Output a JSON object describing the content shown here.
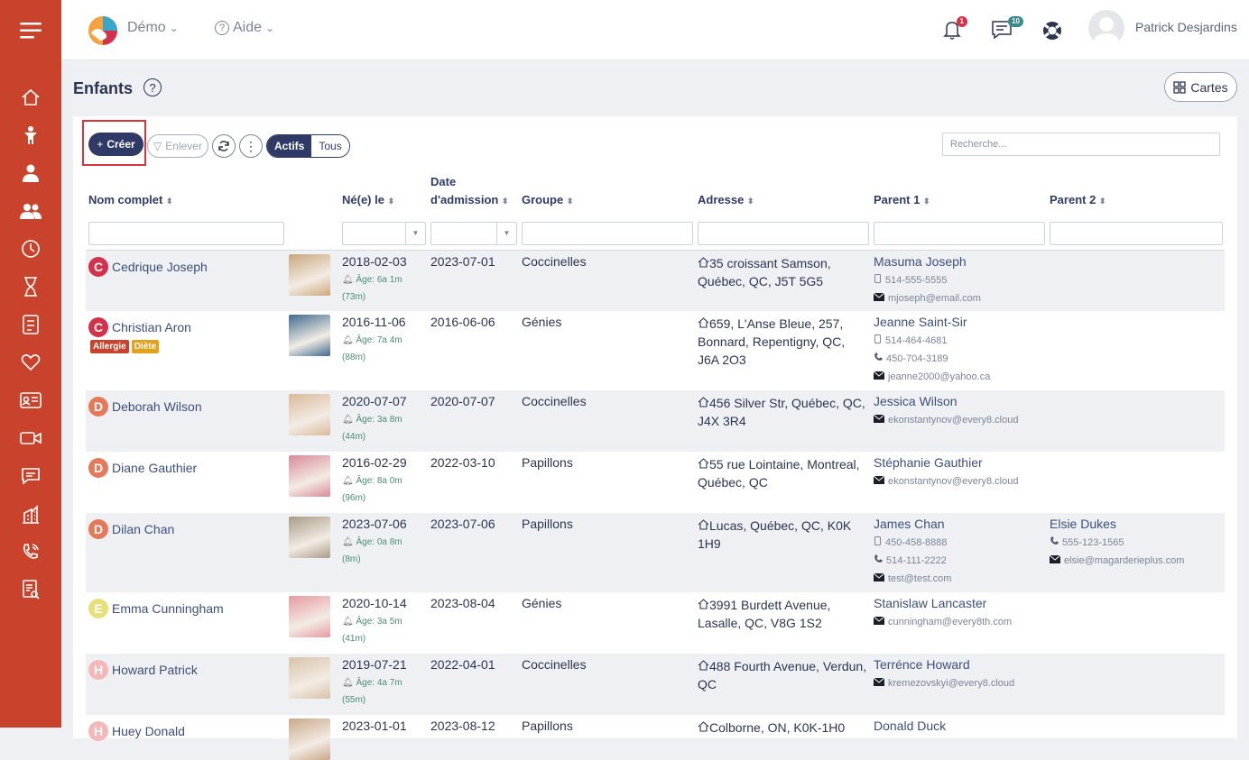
{
  "header": {
    "school": "Démo",
    "help": "Aide",
    "notifications_count": "1",
    "messages_count": "10",
    "user_name": "Patrick Desjardins"
  },
  "page": {
    "title": "Enfants",
    "cards_label": "Cartes"
  },
  "toolbar": {
    "create_label": "Créer",
    "remove_label": "Enlever",
    "active_label": "Actifs",
    "all_label": "Tous",
    "search_placeholder": "Recherche..."
  },
  "columns": {
    "name": "Nom complet",
    "born": "Né(e) le",
    "admission_1": "Date",
    "admission_2": "d'admission",
    "group": "Groupe",
    "address": "Adresse",
    "parent1": "Parent 1",
    "parent2": "Parent 2"
  },
  "rows": [
    {
      "initial": "C",
      "avatar_color": "#d3324a",
      "name": "Cedrique Joseph",
      "photo_color": "#c9a77e",
      "born": "2018-02-03",
      "age": "Âge: 6a 1m",
      "months": "(73m)",
      "admission": "2023-07-01",
      "group": "Coccinelles",
      "address": "35 croissant Samson, Québec, QC, J5T 5G5",
      "p1_name": "Masuma Joseph",
      "p1_phone1": "514-555-5555",
      "p1_phone2": "",
      "p1_email": "mjoseph@email.com",
      "p2_name": "",
      "p2_phone": "",
      "p2_email": ""
    },
    {
      "initial": "C",
      "avatar_color": "#d3324a",
      "name": "Christian Aron",
      "photo_color": "#3e6a8f",
      "born": "2016-11-06",
      "age": "Âge: 7a 4m",
      "months": "(88m)",
      "admission": "2016-06-06",
      "group": "Génies",
      "address": "659, L'Anse Bleue, 257, Bonnard, Repentigny, QC, J6A 2O3",
      "p1_name": "Jeanne Saint-Sir",
      "p1_phone1": "514-464-4681",
      "p1_phone2": "450-704-3189",
      "p1_email": "jeanne2000@yahoo.ca",
      "p2_name": "",
      "p2_phone": "",
      "p2_email": "",
      "tag1": "Allergie",
      "tag2": "Diète"
    },
    {
      "initial": "D",
      "avatar_color": "#e57a5a",
      "name": "Deborah Wilson",
      "photo_color": "#d9b99a",
      "born": "2020-07-07",
      "age": "Âge: 3a 8m",
      "months": "(44m)",
      "admission": "2020-07-07",
      "group": "Coccinelles",
      "address": "456 Silver Str, Québec, QC, J4X 3R4",
      "p1_name": "Jessica Wilson",
      "p1_phone1": "",
      "p1_phone2": "",
      "p1_email": "ekonstantynov@every8.cloud",
      "p2_name": "",
      "p2_phone": "",
      "p2_email": ""
    },
    {
      "initial": "D",
      "avatar_color": "#e57a5a",
      "name": "Diane Gauthier",
      "photo_color": "#d88a9a",
      "born": "2016-02-29",
      "age": "Âge: 8a 0m",
      "months": "(96m)",
      "admission": "2022-03-10",
      "group": "Papillons",
      "address": "55 rue Lointaine, Montreal, Québec, QC",
      "p1_name": "Stéphanie Gauthier",
      "p1_phone1": "",
      "p1_phone2": "",
      "p1_email": "ekonstantynov@every8.cloud",
      "p2_name": "",
      "p2_phone": "",
      "p2_email": ""
    },
    {
      "initial": "D",
      "avatar_color": "#e57a5a",
      "name": "Dilan Chan",
      "photo_color": "#a89c86",
      "born": "2023-07-06",
      "age": "Âge: 0a 8m",
      "months": "(8m)",
      "admission": "2023-07-06",
      "group": "Papillons",
      "address": "Lucas, Québec, QC, K0K 1H9",
      "p1_name": "James Chan",
      "p1_phone1": "450-458-8888",
      "p1_phone2": "514-111-2222",
      "p1_email": "test@test.com",
      "p2_name": "Elsie Dukes",
      "p2_phone": "555-123-1565",
      "p2_email": "elsie@magarderieplus.com"
    },
    {
      "initial": "E",
      "avatar_color": "#e6e07a",
      "name": "Emma Cunningham",
      "photo_color": "#e89aa2",
      "born": "2020-10-14",
      "age": "Âge: 3a 5m",
      "months": "(41m)",
      "admission": "2023-08-04",
      "group": "Génies",
      "address": "3991 Burdett Avenue, Lasalle, QC, V8G 1S2",
      "p1_name": "Stanislaw Lancaster",
      "p1_phone1": "",
      "p1_phone2": "",
      "p1_email": "cunningham@every8th.com",
      "p2_name": "",
      "p2_phone": "",
      "p2_email": ""
    },
    {
      "initial": "H",
      "avatar_color": "#f4b8b8",
      "name": "Howard Patrick",
      "photo_color": "#d8c2a8",
      "born": "2019-07-21",
      "age": "Âge: 4a 7m",
      "months": "(55m)",
      "admission": "2022-04-01",
      "group": "Coccinelles",
      "address": "488 Fourth Avenue, Verdun, QC",
      "p1_name": "Terrénce Howard",
      "p1_phone1": "",
      "p1_phone2": "",
      "p1_email": "kremezovskyi@every8.cloud",
      "p2_name": "",
      "p2_phone": "",
      "p2_email": ""
    },
    {
      "initial": "H",
      "avatar_color": "#f4b8b8",
      "name": "Huey Donald",
      "photo_color": "#c9a88a",
      "born": "2023-01-01",
      "age": "",
      "months": "",
      "admission": "2023-08-12",
      "group": "Papillons",
      "address": "Colborne, ON, K0K-1H0",
      "p1_name": "Donald Duck",
      "p1_phone1": "",
      "p1_phone2": "",
      "p1_email": "",
      "p2_name": "",
      "p2_phone": "",
      "p2_email": ""
    }
  ]
}
